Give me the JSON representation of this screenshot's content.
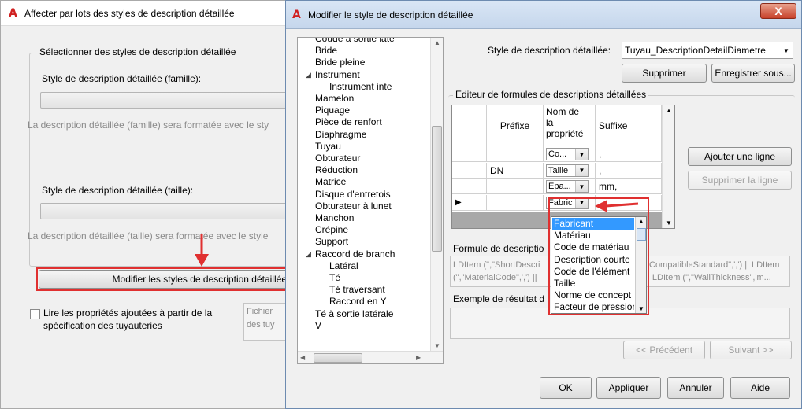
{
  "back_dialog": {
    "title": "Affecter par lots des styles de description détaillée",
    "groupbox_label": "Sélectionner des styles de description détaillée",
    "family_label": "Style de description détaillée (famille):",
    "family_note": "La description détaillée (famille) sera formatée avec le sty",
    "size_label": "Style de description détaillée (taille):",
    "size_note": "La description détaillée (taille) sera formatée avec le style",
    "modify_button": "Modifier les styles de description détaillée",
    "checkbox_label_line1": "Lire les propriétés ajoutées à partir de la",
    "checkbox_label_line2": "spécification des tuyauteries",
    "hidden_text_line1": "Fichier",
    "hidden_text_line2": "des tuy"
  },
  "front_dialog": {
    "title": "Modifier le style de description détaillée",
    "close_symbol": "X",
    "style_label": "Style de description détaillée:",
    "style_value": "Tuyau_DescriptionDetailDiametre",
    "delete_button": "Supprimer",
    "save_as_button": "Enregistrer sous...",
    "editor_label": "Editeur de formules de descriptions détaillées",
    "grid": {
      "headers": {
        "prefix": "Préfixe",
        "property_line1": "Nom de",
        "property_line2": "la",
        "property_line3": "propriété",
        "suffix": "Suffixe"
      },
      "rows": [
        {
          "prefix": "",
          "property": "Co...",
          "suffix": ","
        },
        {
          "prefix": "DN",
          "property": "Taille",
          "suffix": ","
        },
        {
          "prefix": "",
          "property": "Epa...",
          "suffix": "mm,"
        },
        {
          "prefix": "",
          "property": "Fabric",
          "suffix": ""
        }
      ],
      "row_pointer": "▶"
    },
    "add_row_button": "Ajouter une ligne",
    "delete_row_button": "Supprimer la ligne",
    "formula_label": "Formule de descriptio",
    "formula_text_line1": "LDItem (\",\"ShortDescri",
    "formula_text_line1b": "CompatibleStandard\",',') || LDItem",
    "formula_text_line2": "(\",\"MaterialCode\",',') ||",
    "formula_text_line2b": "| LDItem (\",\"WallThickness\",'m...",
    "example_label": "Exemple de résultat d",
    "prev_button": "<< Précédent",
    "next_button": "Suivant >>",
    "ok_button": "OK",
    "apply_button": "Appliquer",
    "cancel_button": "Annuler",
    "help_button": "Aide",
    "dropdown_options": [
      "Fabricant",
      "Matériau",
      "Code de matériau",
      "Description courte",
      "Code de l'élément",
      "Taille",
      "Norme de concept",
      "Facteur de pression"
    ],
    "tree": [
      {
        "label": "Coude à sortie laté",
        "indent": 1
      },
      {
        "label": "Bride",
        "indent": 1
      },
      {
        "label": "Bride pleine",
        "indent": 1
      },
      {
        "label": "Instrument",
        "indent": 1,
        "expanded": true
      },
      {
        "label": "Instrument inte",
        "indent": 2
      },
      {
        "label": "Mamelon",
        "indent": 1
      },
      {
        "label": "Piquage",
        "indent": 1
      },
      {
        "label": "Pièce de renfort",
        "indent": 1
      },
      {
        "label": "Diaphragme",
        "indent": 1
      },
      {
        "label": "Tuyau",
        "indent": 1
      },
      {
        "label": "Obturateur",
        "indent": 1
      },
      {
        "label": "Réduction",
        "indent": 1
      },
      {
        "label": "Matrice",
        "indent": 1
      },
      {
        "label": "Disque d'entretois",
        "indent": 1
      },
      {
        "label": "Obturateur à lunet",
        "indent": 1
      },
      {
        "label": "Manchon",
        "indent": 1
      },
      {
        "label": "Crépine",
        "indent": 1
      },
      {
        "label": "Support",
        "indent": 1
      },
      {
        "label": "Raccord de branch",
        "indent": 1,
        "expanded": true
      },
      {
        "label": "Latéral",
        "indent": 2
      },
      {
        "label": "Té",
        "indent": 2
      },
      {
        "label": "Té traversant",
        "indent": 2
      },
      {
        "label": "Raccord en Y",
        "indent": 2
      },
      {
        "label": "Té à sortie latérale",
        "indent": 1
      },
      {
        "label": "V",
        "indent": 1
      }
    ]
  },
  "colors": {
    "accent_red": "#e03030",
    "selection_blue": "#3399ff"
  }
}
